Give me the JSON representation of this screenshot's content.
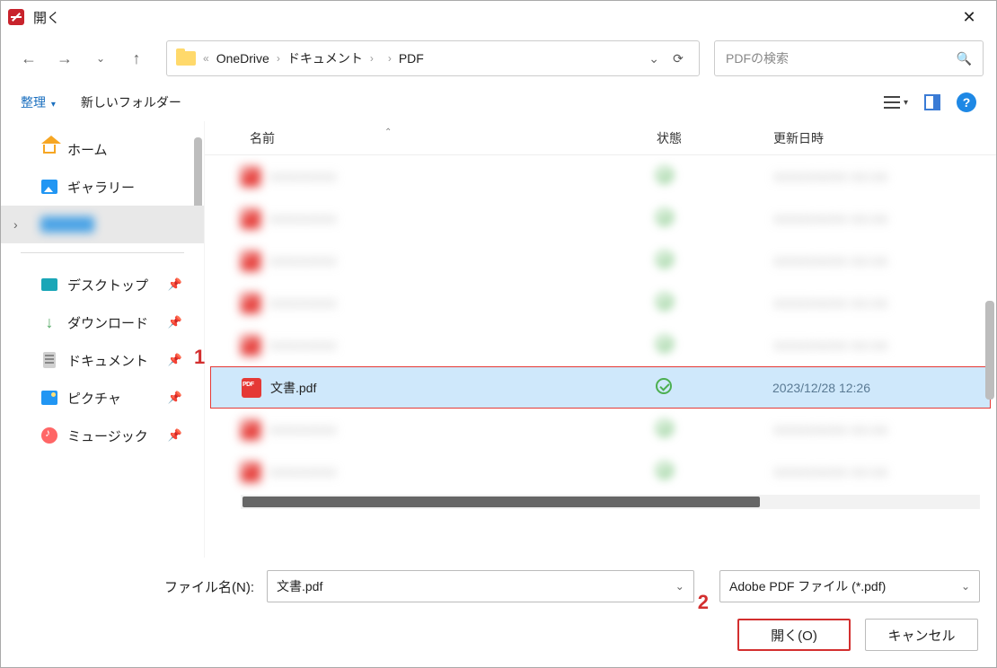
{
  "titlebar": {
    "title": "開く"
  },
  "nav": {
    "breadcrumb": {
      "root": "OneDrive",
      "folder1": "ドキュメント",
      "folder2_blur": "  ",
      "folder3": "PDF"
    },
    "search_placeholder": "PDFの検索"
  },
  "toolbar": {
    "organize": "整理",
    "new_folder": "新しいフォルダー"
  },
  "sidebar": {
    "home": "ホーム",
    "gallery": "ギャラリー",
    "quick": {
      "desktop": "デスクトップ",
      "downloads": "ダウンロード",
      "documents": "ドキュメント",
      "pictures": "ピクチャ",
      "music": "ミュージック"
    }
  },
  "columns": {
    "name": "名前",
    "state": "状態",
    "date": "更新日時"
  },
  "files": {
    "selected": {
      "name": "文書.pdf",
      "date": "2023/12/28 12:26"
    },
    "blur_name": "XXXXXXXX",
    "blur_date": "XXXX/XX/XX XX:XX"
  },
  "markers": {
    "one": "1",
    "two": "2"
  },
  "footer": {
    "filename_label": "ファイル名(N):",
    "filename_value": "文書.pdf",
    "filter": "Adobe PDF ファイル (*.pdf)",
    "open": "開く(O)",
    "cancel": "キャンセル"
  }
}
